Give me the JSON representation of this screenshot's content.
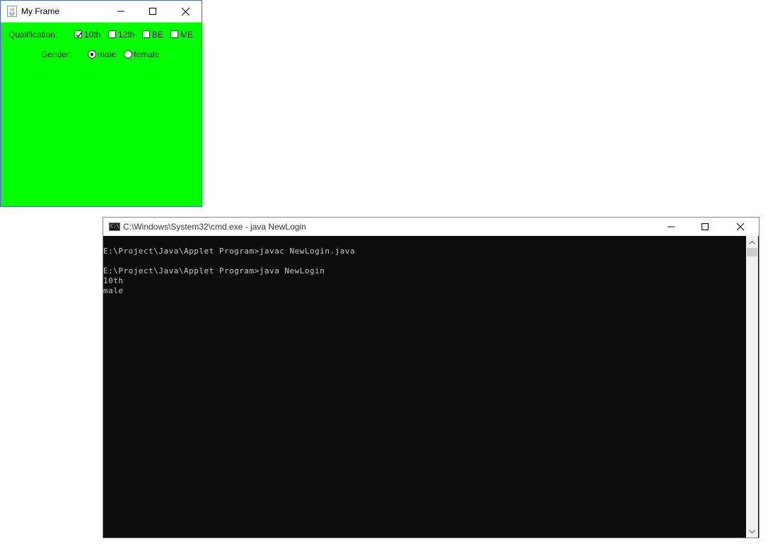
{
  "frame": {
    "title": "My Frame",
    "qualification_label": "Qualification:",
    "qualifications": [
      {
        "label": "10th",
        "checked": true
      },
      {
        "label": "12th",
        "checked": false
      },
      {
        "label": "BE",
        "checked": false
      },
      {
        "label": "ME",
        "checked": false
      }
    ],
    "gender_label": "Gender:",
    "genders": [
      {
        "label": "male",
        "selected": true
      },
      {
        "label": "female",
        "selected": false
      }
    ],
    "background_color": "#00ff00"
  },
  "console": {
    "title": "C:\\Windows\\System32\\cmd.exe - java  NewLogin",
    "icon_text": "C:\\",
    "lines": [
      "E:\\Project\\Java\\Applet Program>javac NewLogin.java",
      "",
      "E:\\Project\\Java\\Applet Program>java NewLogin",
      "10th",
      "male"
    ]
  }
}
